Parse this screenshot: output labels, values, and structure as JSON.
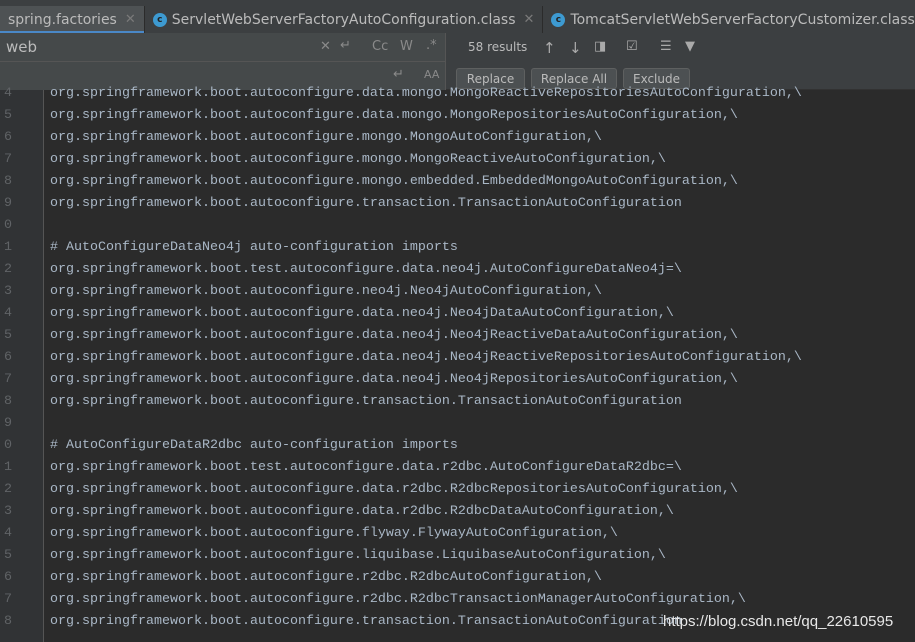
{
  "tabs": [
    {
      "label": "spring.factories",
      "active": true,
      "icon": "properties-file-icon"
    },
    {
      "label": "ServletWebServerFactoryAutoConfiguration.class",
      "active": false,
      "icon": "class-icon"
    },
    {
      "label": "TomcatServletWebServerFactoryCustomizer.class",
      "active": false,
      "icon": "class-icon"
    }
  ],
  "search": {
    "find_value": "web",
    "replace_value": "",
    "results": "58 results",
    "match_case": "Cc",
    "words": "W",
    "regex": ".*",
    "replace_label": "Replace",
    "replace_all_label": "Replace All",
    "exclude_label": "Exclude"
  },
  "colors": {
    "background": "#2b2b2b",
    "text": "#a9b7c6",
    "accent": "#4a88c7"
  },
  "lines": [
    {
      "n": "4",
      "t": "org.springframework.boot.autoconfigure.data.mongo.MongoReactiveRepositoriesAutoConfiguration,\\"
    },
    {
      "n": "5",
      "t": "org.springframework.boot.autoconfigure.data.mongo.MongoRepositoriesAutoConfiguration,\\"
    },
    {
      "n": "6",
      "t": "org.springframework.boot.autoconfigure.mongo.MongoAutoConfiguration,\\"
    },
    {
      "n": "7",
      "t": "org.springframework.boot.autoconfigure.mongo.MongoReactiveAutoConfiguration,\\"
    },
    {
      "n": "8",
      "t": "org.springframework.boot.autoconfigure.mongo.embedded.EmbeddedMongoAutoConfiguration,\\"
    },
    {
      "n": "9",
      "t": "org.springframework.boot.autoconfigure.transaction.TransactionAutoConfiguration"
    },
    {
      "n": "0",
      "t": ""
    },
    {
      "n": "1",
      "t": "# AutoConfigureDataNeo4j auto-configuration imports"
    },
    {
      "n": "2",
      "t": "org.springframework.boot.test.autoconfigure.data.neo4j.AutoConfigureDataNeo4j=\\"
    },
    {
      "n": "3",
      "t": "org.springframework.boot.autoconfigure.neo4j.Neo4jAutoConfiguration,\\"
    },
    {
      "n": "4",
      "t": "org.springframework.boot.autoconfigure.data.neo4j.Neo4jDataAutoConfiguration,\\"
    },
    {
      "n": "5",
      "t": "org.springframework.boot.autoconfigure.data.neo4j.Neo4jReactiveDataAutoConfiguration,\\"
    },
    {
      "n": "6",
      "t": "org.springframework.boot.autoconfigure.data.neo4j.Neo4jReactiveRepositoriesAutoConfiguration,\\"
    },
    {
      "n": "7",
      "t": "org.springframework.boot.autoconfigure.data.neo4j.Neo4jRepositoriesAutoConfiguration,\\"
    },
    {
      "n": "8",
      "t": "org.springframework.boot.autoconfigure.transaction.TransactionAutoConfiguration"
    },
    {
      "n": "9",
      "t": ""
    },
    {
      "n": "0",
      "t": "# AutoConfigureDataR2dbc auto-configuration imports"
    },
    {
      "n": "1",
      "t": "org.springframework.boot.test.autoconfigure.data.r2dbc.AutoConfigureDataR2dbc=\\"
    },
    {
      "n": "2",
      "t": "org.springframework.boot.autoconfigure.data.r2dbc.R2dbcRepositoriesAutoConfiguration,\\"
    },
    {
      "n": "3",
      "t": "org.springframework.boot.autoconfigure.data.r2dbc.R2dbcDataAutoConfiguration,\\"
    },
    {
      "n": "4",
      "t": "org.springframework.boot.autoconfigure.flyway.FlywayAutoConfiguration,\\"
    },
    {
      "n": "5",
      "t": "org.springframework.boot.autoconfigure.liquibase.LiquibaseAutoConfiguration,\\"
    },
    {
      "n": "6",
      "t": "org.springframework.boot.autoconfigure.r2dbc.R2dbcAutoConfiguration,\\"
    },
    {
      "n": "7",
      "t": "org.springframework.boot.autoconfigure.r2dbc.R2dbcTransactionManagerAutoConfiguration,\\"
    },
    {
      "n": "8",
      "t": "org.springframework.boot.autoconfigure.transaction.TransactionAutoConfiguration"
    }
  ],
  "watermark": "https://blog.csdn.net/qq_22610595"
}
